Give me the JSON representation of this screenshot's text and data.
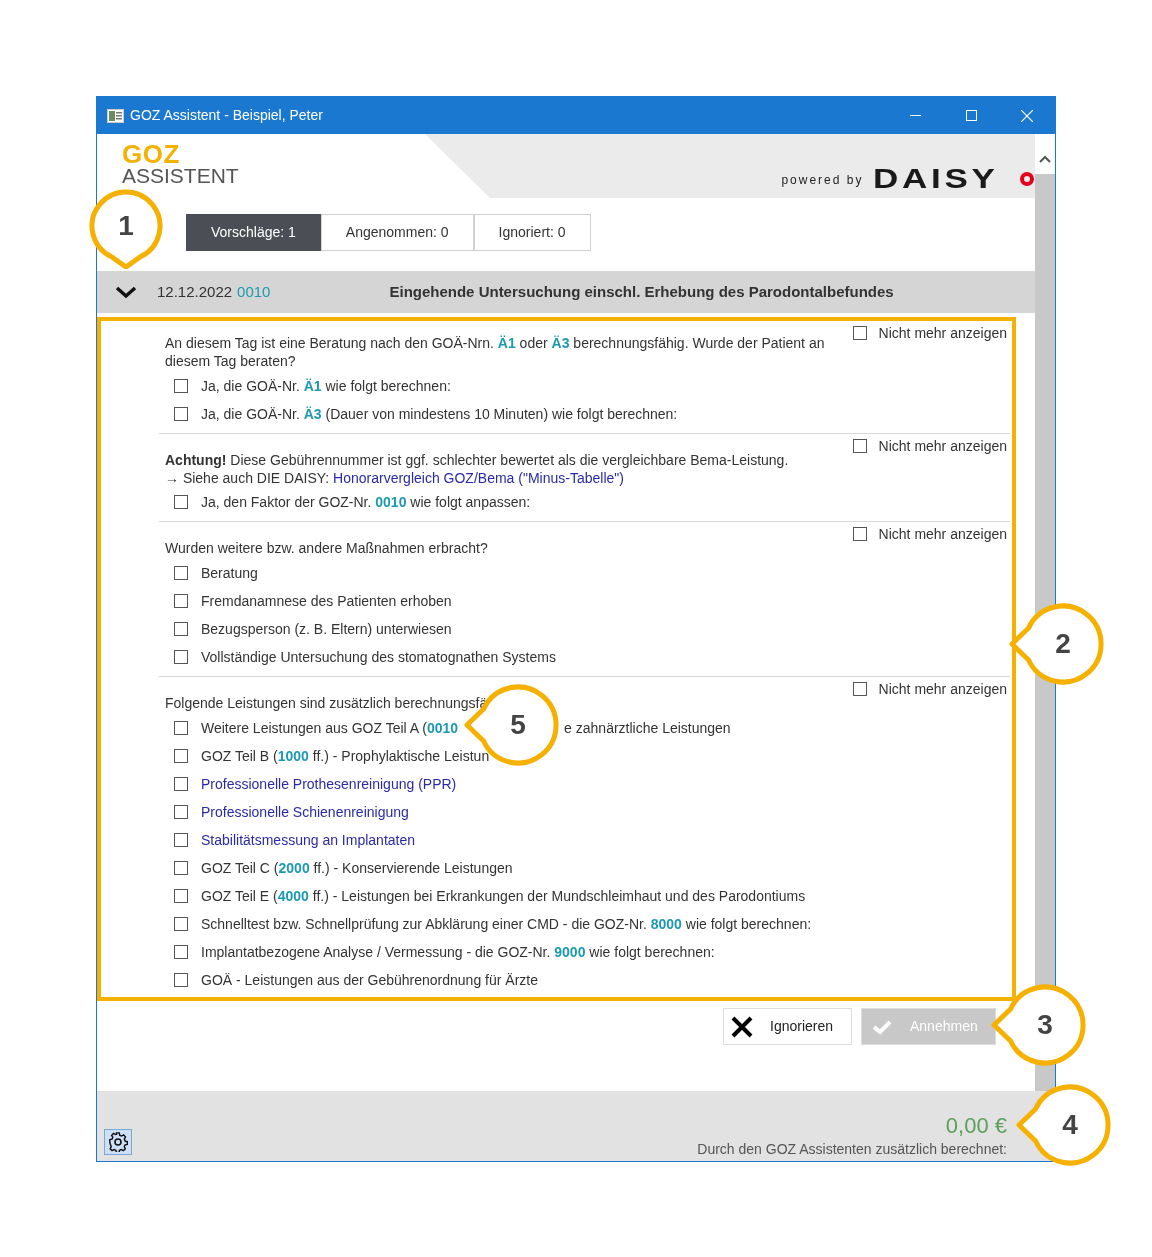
{
  "window": {
    "title": "GOZ Assistent - Beispiel, Peter"
  },
  "logo": {
    "line1": "GOZ",
    "line2": "ASSISTENT"
  },
  "powered_by": {
    "text": "powered by",
    "brand": "DAISY"
  },
  "tabs": [
    {
      "label": "Vorschläge: 1",
      "selected": true
    },
    {
      "label": "Angenommen: 0",
      "selected": false
    },
    {
      "label": "Ignoriert: 0",
      "selected": false
    }
  ],
  "entry": {
    "expanded": true,
    "date": "12.12.2022",
    "code": "0010",
    "title": "Eingehende Untersuchung einschl. Erhebung des Parodontalbefundes"
  },
  "sections": [
    {
      "opt_out": {
        "label": "Nicht mehr anzeigen",
        "checked": false
      },
      "lines": [
        {
          "kind": "text",
          "text": "An diesem Tag ist eine Beratung nach den GOÄ-Nrn. **Ä1** oder **Ä3** berechnungsfähig. Wurde der Patient an diesem Tag beraten?"
        }
      ],
      "options": [
        {
          "kind": "plain",
          "label": "Ja, die GOÄ-Nr. **Ä1** wie folgt berechnen:",
          "checked": false
        },
        {
          "kind": "plain",
          "label": "Ja, die GOÄ-Nr. **Ä3** (Dauer von mindestens 10 Minuten) wie folgt berechnen:",
          "checked": false
        }
      ]
    },
    {
      "opt_out": {
        "label": "Nicht mehr anzeigen",
        "checked": false
      },
      "lines": [
        {
          "kind": "warning",
          "text": "**Achtung!** Diese Gebührennummer ist ggf. schlechter bewertet als die vergleichbare Bema-Leistung."
        },
        {
          "kind": "reference",
          "text": "→ Siehe auch DIE DAISY:",
          "link": "Honorarvergleich GOZ/Bema (\"Minus-Tabelle\")"
        }
      ],
      "options": [
        {
          "kind": "plain",
          "label": "Ja, den Faktor der GOZ-Nr. **0010** wie folgt anpassen:",
          "checked": false
        }
      ]
    },
    {
      "opt_out": {
        "label": "Nicht mehr anzeigen",
        "checked": false
      },
      "lines": [
        {
          "kind": "text",
          "text": "Wurden weitere bzw. andere Maßnahmen erbracht?"
        }
      ],
      "options": [
        {
          "kind": "plain",
          "label": "Beratung",
          "checked": false
        },
        {
          "kind": "plain",
          "label": "Fremdanamnese des Patienten erhoben",
          "checked": false
        },
        {
          "kind": "plain",
          "label": "Bezugsperson (z. B. Eltern) unterwiesen",
          "checked": false
        },
        {
          "kind": "plain",
          "label": "Vollständige Untersuchung des stomatognathen Systems",
          "checked": false
        }
      ]
    },
    {
      "opt_out": {
        "label": "Nicht mehr anzeigen",
        "checked": false
      },
      "lines": [
        {
          "kind": "text",
          "text": "Folgende Leistungen sind zusätzlich berechnungsfä"
        }
      ],
      "options": [
        {
          "kind": "plain",
          "label": "Weitere Leistungen aus GOZ Teil A (**0010**",
          "label_after": "e zahnärztliche Leistungen",
          "checked": false
        },
        {
          "kind": "plain",
          "label": "GOZ Teil B (**1000** ff.) - Prophylaktische Leistun",
          "checked": false
        },
        {
          "kind": "link",
          "label": "Professionelle Prothesenreinigung (PPR)",
          "checked": false
        },
        {
          "kind": "link",
          "label": "Professionelle Schienenreinigung",
          "checked": false
        },
        {
          "kind": "link",
          "label": "Stabilitätsmessung an Implantaten",
          "checked": false
        },
        {
          "kind": "plain",
          "label": "GOZ Teil C (**2000** ff.) - Konservierende Leistungen",
          "checked": false
        },
        {
          "kind": "plain",
          "label": "GOZ Teil E (**4000** ff.) - Leistungen bei Erkrankungen der Mundschleimhaut und des Parodontiums",
          "checked": false
        },
        {
          "kind": "plain",
          "label": "Schnelltest bzw. Schnellprüfung zur Abklärung einer CMD - die GOZ-Nr. **8000** wie folgt berechnen:",
          "checked": false
        },
        {
          "kind": "plain",
          "label": "Implantatbezogene Analyse / Vermessung - die GOZ-Nr. **9000** wie folgt berechnen:",
          "checked": false
        },
        {
          "kind": "plain",
          "label": "GOÄ - Leistungen aus der Gebührenordnung für Ärzte",
          "checked": false
        }
      ]
    }
  ],
  "buttons": [
    {
      "kind": "ignore",
      "label": "Ignorieren",
      "disabled": false
    },
    {
      "kind": "accept",
      "label": "Annehmen",
      "disabled": true
    }
  ],
  "footer": {
    "amount": "0,00 €",
    "caption": "Durch den GOZ Assistenten zusätzlich berechnet:"
  },
  "callouts": [
    {
      "label": "1",
      "kind": "down"
    },
    {
      "label": "2",
      "kind": "left"
    },
    {
      "label": "3",
      "kind": "left"
    },
    {
      "label": "4",
      "kind": "left"
    },
    {
      "label": "5",
      "kind": "left"
    }
  ]
}
